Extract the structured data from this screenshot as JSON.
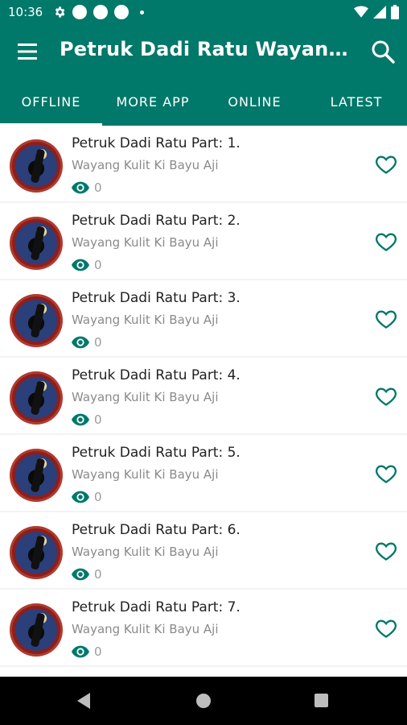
{
  "status_bar": {
    "time": "10:36"
  },
  "app_bar": {
    "title": "Petruk Dadi Ratu Wayang K..."
  },
  "tabs": [
    {
      "label": "OFFLINE",
      "selected": true
    },
    {
      "label": "MORE APP",
      "selected": false
    },
    {
      "label": "ONLINE",
      "selected": false
    },
    {
      "label": "LATEST",
      "selected": false
    }
  ],
  "colors": {
    "primary": "#00786a",
    "accent": "#00786a"
  },
  "items": [
    {
      "title": "Petruk Dadi Ratu Part: 1.",
      "subtitle": "Wayang Kulit Ki Bayu Aji",
      "views": "0"
    },
    {
      "title": "Petruk Dadi Ratu Part: 2.",
      "subtitle": "Wayang Kulit Ki Bayu Aji",
      "views": "0"
    },
    {
      "title": "Petruk Dadi Ratu Part: 3.",
      "subtitle": "Wayang Kulit Ki Bayu Aji",
      "views": "0"
    },
    {
      "title": "Petruk Dadi Ratu Part: 4.",
      "subtitle": "Wayang Kulit Ki Bayu Aji",
      "views": "0"
    },
    {
      "title": "Petruk Dadi Ratu Part: 5.",
      "subtitle": "Wayang Kulit Ki Bayu Aji",
      "views": "0"
    },
    {
      "title": "Petruk Dadi Ratu Part: 6.",
      "subtitle": "Wayang Kulit Ki Bayu Aji",
      "views": "0"
    },
    {
      "title": "Petruk Dadi Ratu Part: 7.",
      "subtitle": "Wayang Kulit Ki Bayu Aji",
      "views": "0"
    }
  ]
}
